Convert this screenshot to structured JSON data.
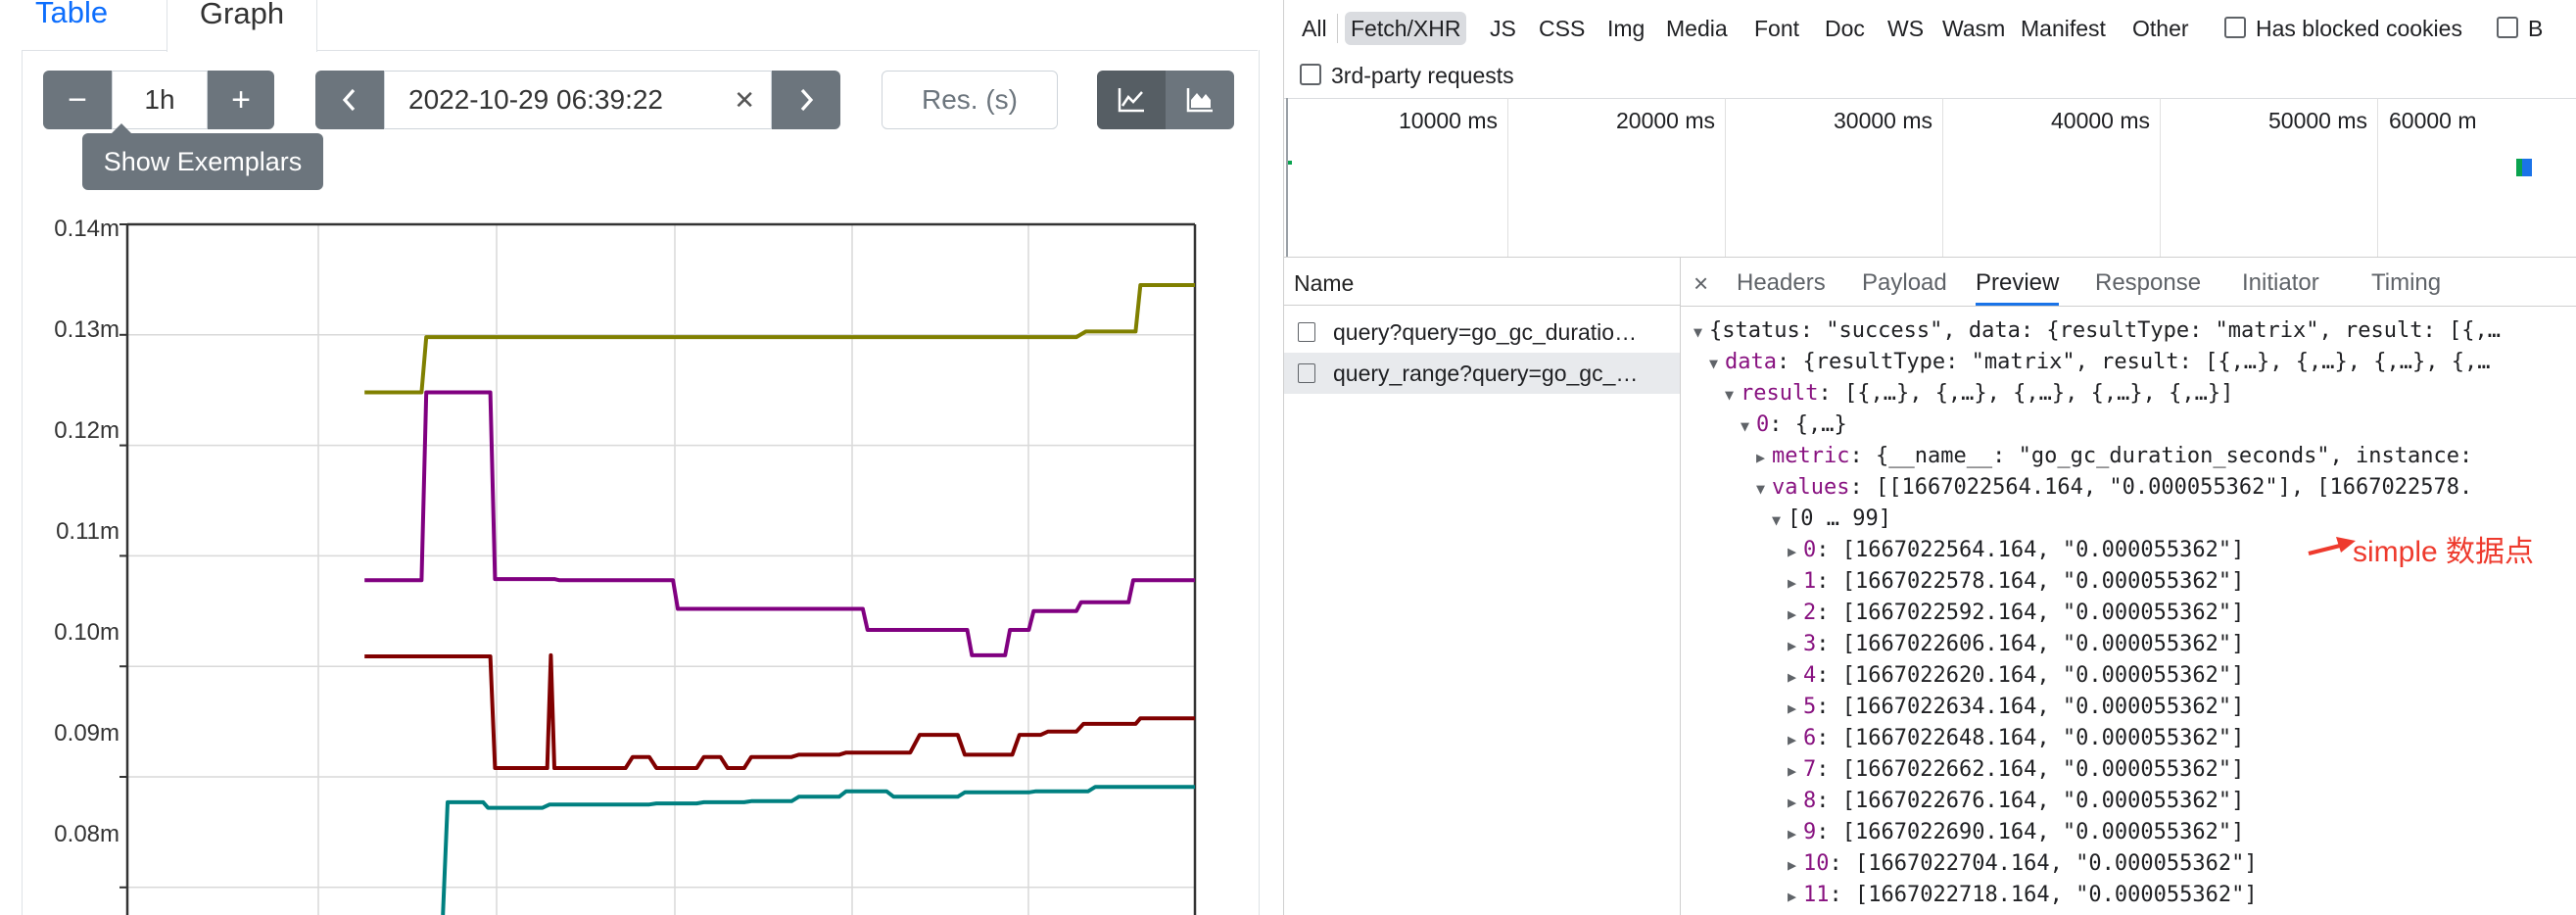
{
  "left": {
    "tabs": {
      "table": "Table",
      "graph": "Graph"
    },
    "controls": {
      "minus": "−",
      "range": "1h",
      "plus": "+",
      "prev": "‹",
      "end_time": "2022-10-29 06:39:22",
      "clear": "✕",
      "next": "›",
      "resolution_placeholder": "Res. (s)",
      "show_exemplars": "Show Exemplars"
    },
    "chart_data": {
      "type": "line",
      "xlabel": "",
      "ylabel": "",
      "y_ticks": [
        "0.14m",
        "0.13m",
        "0.12m",
        "0.11m",
        "0.10m",
        "0.09m",
        "0.08m"
      ],
      "ylim": [
        7.75e-05,
        0.00014
      ],
      "grid": true,
      "series": [
        {
          "color": "#808000",
          "x": [
            0,
            2.4,
            2.6,
            30,
            30.4,
            32.5,
            32.7,
            35
          ],
          "y": [
            0.0001248,
            0.0001248,
            0.0001298,
            0.0001298,
            0.0001303,
            0.0001303,
            0.0001345,
            0.0001345
          ]
        },
        {
          "color": "#800080",
          "x": [
            0,
            2.4,
            2.6,
            5.3,
            5.5,
            8,
            8.2,
            13,
            13.2,
            21,
            21.2,
            25.4,
            25.6,
            27,
            27.2,
            28,
            28.2,
            30,
            30.2,
            32.2,
            32.4,
            35
          ],
          "y": [
            0.0001078,
            0.0001078,
            0.0001248,
            0.0001248,
            0.0001079,
            0.0001079,
            0.0001078,
            0.0001078,
            0.0001052,
            0.0001052,
            0.0001033,
            0.0001033,
            0.000101,
            0.000101,
            0.0001033,
            0.0001033,
            0.000105,
            0.000105,
            0.0001058,
            0.0001058,
            0.0001078,
            0.0001078
          ]
        },
        {
          "color": "#800000",
          "x": [
            0,
            5.3,
            5.5,
            7.7,
            7.85,
            8,
            8.3,
            11,
            11.3,
            12,
            12.3,
            14,
            14.3,
            15,
            15.3,
            16,
            16.3,
            18,
            18.3,
            20,
            20.3,
            23,
            23.4,
            25,
            25.3,
            27.3,
            27.6,
            28.5,
            28.8,
            30,
            30.3,
            32.5,
            32.7,
            35
          ],
          "y": [
            0.0001009,
            0.0001009,
            9.08e-05,
            9.08e-05,
            0.000101,
            9.08e-05,
            9.08e-05,
            9.08e-05,
            9.18e-05,
            9.18e-05,
            9.08e-05,
            9.08e-05,
            9.18e-05,
            9.18e-05,
            9.08e-05,
            9.08e-05,
            9.18e-05,
            9.18e-05,
            9.2e-05,
            9.2e-05,
            9.22e-05,
            9.22e-05,
            9.38e-05,
            9.38e-05,
            9.2e-05,
            9.2e-05,
            9.38e-05,
            9.38e-05,
            9.41e-05,
            9.41e-05,
            9.48e-05,
            9.48e-05,
            9.53e-05,
            9.53e-05
          ]
        },
        {
          "color": "#008080",
          "x": [
            3.3,
            3.5,
            5,
            5.2,
            7.5,
            7.8,
            12,
            12.3,
            14,
            14.3,
            16,
            16.3,
            18,
            18.3,
            20,
            20.3,
            22,
            22.3,
            25,
            25.3,
            28,
            28.3,
            30.5,
            30.8,
            35
          ],
          "y": [
            7.75e-05,
            8.77e-05,
            8.77e-05,
            8.72e-05,
            8.72e-05,
            8.75e-05,
            8.75e-05,
            8.76e-05,
            8.76e-05,
            8.77e-05,
            8.77e-05,
            8.78e-05,
            8.78e-05,
            8.82e-05,
            8.82e-05,
            8.87e-05,
            8.87e-05,
            8.82e-05,
            8.82e-05,
            8.86e-05,
            8.86e-05,
            8.87e-05,
            8.87e-05,
            8.91e-05,
            8.91e-05
          ]
        }
      ],
      "xlim": [
        -10,
        35
      ]
    }
  },
  "right": {
    "filters": [
      "All",
      "Fetch/XHR",
      "JS",
      "CSS",
      "Img",
      "Media",
      "Font",
      "Doc",
      "WS",
      "Wasm",
      "Manifest",
      "Other"
    ],
    "active_filter": "Fetch/XHR",
    "has_blocked_cookies": "Has blocked cookies",
    "blocked_requests_partial": "B",
    "third_party": "3rd-party requests",
    "timeline_labels": [
      "10000 ms",
      "20000 ms",
      "30000 ms",
      "40000 ms",
      "50000 ms",
      "60000 m"
    ],
    "name_header": "Name",
    "requests": [
      "query?query=go_gc_duratio…",
      "query_range?query=go_gc_…"
    ],
    "detail_close": "×",
    "detail_tabs": [
      "Headers",
      "Payload",
      "Preview",
      "Response",
      "Initiator",
      "Timing"
    ],
    "active_detail_tab": "Preview",
    "preview": {
      "l1": "{status: \"success\", data: {resultType: \"matrix\", result: [{,…",
      "l2_key": "data",
      "l2": ": {resultType: \"matrix\", result: [{,…}, {,…}, {,…}, {,…",
      "l3_key": "result",
      "l3": ": [{,…}, {,…}, {,…}, {,…}, {,…}]",
      "l4_key": "0",
      "l4": ": {,…}",
      "l5_key": "metric",
      "l5": ": {__name__: \"go_gc_duration_seconds\", instance:",
      "l6_key": "values",
      "l6": ": [[1667022564.164, \"0.000055362\"], [1667022578.",
      "l7": "[0 … 99]",
      "values": [
        {
          "i": "0",
          "v": ": [1667022564.164, \"0.000055362\"]"
        },
        {
          "i": "1",
          "v": ": [1667022578.164, \"0.000055362\"]"
        },
        {
          "i": "2",
          "v": ": [1667022592.164, \"0.000055362\"]"
        },
        {
          "i": "3",
          "v": ": [1667022606.164, \"0.000055362\"]"
        },
        {
          "i": "4",
          "v": ": [1667022620.164, \"0.000055362\"]"
        },
        {
          "i": "5",
          "v": ": [1667022634.164, \"0.000055362\"]"
        },
        {
          "i": "6",
          "v": ": [1667022648.164, \"0.000055362\"]"
        },
        {
          "i": "7",
          "v": ": [1667022662.164, \"0.000055362\"]"
        },
        {
          "i": "8",
          "v": ": [1667022676.164, \"0.000055362\"]"
        },
        {
          "i": "9",
          "v": ": [1667022690.164, \"0.000055362\"]"
        },
        {
          "i": "10",
          "v": ": [1667022704.164, \"0.000055362\"]"
        },
        {
          "i": "11",
          "v": ": [1667022718.164, \"0.000055362\"]"
        }
      ]
    },
    "annotation": "simple 数据点"
  },
  "colors": {
    "accent": "#0d6efd",
    "devtools_tab_active": "#1a73e8",
    "annotation": "#ee3a2d"
  }
}
